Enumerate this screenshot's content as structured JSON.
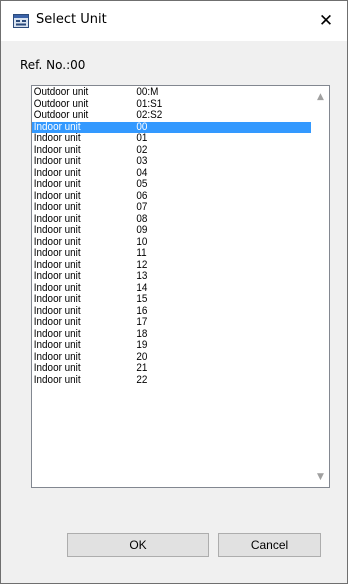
{
  "window": {
    "title": "Select Unit",
    "close_glyph": "✕"
  },
  "ref_label": "Ref. No.:00",
  "list": {
    "rows": [
      {
        "name": "Outdoor unit",
        "num": "00:M"
      },
      {
        "name": "Outdoor unit",
        "num": "01:S1"
      },
      {
        "name": "Outdoor unit",
        "num": "02:S2"
      },
      {
        "name": "Indoor unit",
        "num": "00",
        "selected": true
      },
      {
        "name": "Indoor unit",
        "num": "01"
      },
      {
        "name": "Indoor unit",
        "num": "02"
      },
      {
        "name": "Indoor unit",
        "num": "03"
      },
      {
        "name": "Indoor unit",
        "num": "04"
      },
      {
        "name": "Indoor unit",
        "num": "05"
      },
      {
        "name": "Indoor unit",
        "num": "06"
      },
      {
        "name": "Indoor unit",
        "num": "07"
      },
      {
        "name": "Indoor unit",
        "num": "08"
      },
      {
        "name": "Indoor unit",
        "num": "09"
      },
      {
        "name": "Indoor unit",
        "num": "10"
      },
      {
        "name": "Indoor unit",
        "num": "11"
      },
      {
        "name": "Indoor unit",
        "num": "12"
      },
      {
        "name": "Indoor unit",
        "num": "13"
      },
      {
        "name": "Indoor unit",
        "num": "14"
      },
      {
        "name": "Indoor unit",
        "num": "15"
      },
      {
        "name": "Indoor unit",
        "num": "16"
      },
      {
        "name": "Indoor unit",
        "num": "17"
      },
      {
        "name": "Indoor unit",
        "num": "18"
      },
      {
        "name": "Indoor unit",
        "num": "19"
      },
      {
        "name": "Indoor unit",
        "num": "20"
      },
      {
        "name": "Indoor unit",
        "num": "21"
      },
      {
        "name": "Indoor unit",
        "num": "22"
      }
    ],
    "scroll_up_glyph": "▲",
    "scroll_down_glyph": "▼"
  },
  "buttons": {
    "ok_label": "OK",
    "cancel_label": "Cancel"
  },
  "colors": {
    "selection": "#3399ff",
    "selection_text": "#ffffff"
  },
  "icons": {
    "app": "app-window-icon",
    "close": "close-icon",
    "scroll_up": "scroll-up-arrow-icon",
    "scroll_down": "scroll-down-arrow-icon"
  }
}
